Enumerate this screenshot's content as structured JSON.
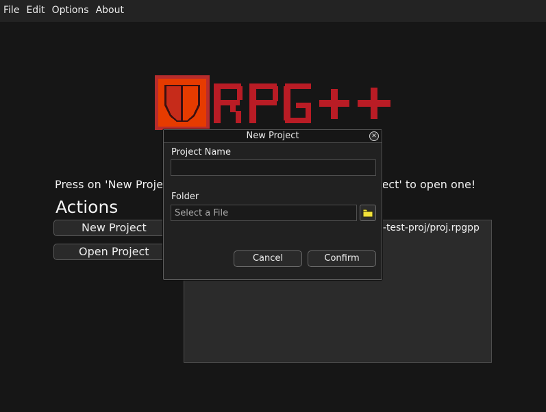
{
  "menubar": {
    "items": [
      "File",
      "Edit",
      "Options",
      "About"
    ]
  },
  "logo": {
    "text": "RPG++",
    "colors": {
      "badge_bg": "#e63b00",
      "badge_border": "#b72c2c",
      "text": "#b91c25",
      "shield": "#c62b1a"
    }
  },
  "main": {
    "instruction_left": "Press on 'New Proje",
    "instruction_right": "roject' to open one!",
    "actions_heading": "Actions",
    "new_project_label": "New Project",
    "open_project_label": "Open Project",
    "recent_item": "p-test-proj/proj.rpgpp"
  },
  "dialog": {
    "title": "New Project",
    "project_name_label": "Project Name",
    "project_name_value": "",
    "folder_label": "Folder",
    "folder_placeholder": "Select a File",
    "cancel_label": "Cancel",
    "confirm_label": "Confirm"
  },
  "colors": {
    "background": "#161616",
    "menubar": "#232323",
    "folder_icon": "#f2e23a"
  }
}
